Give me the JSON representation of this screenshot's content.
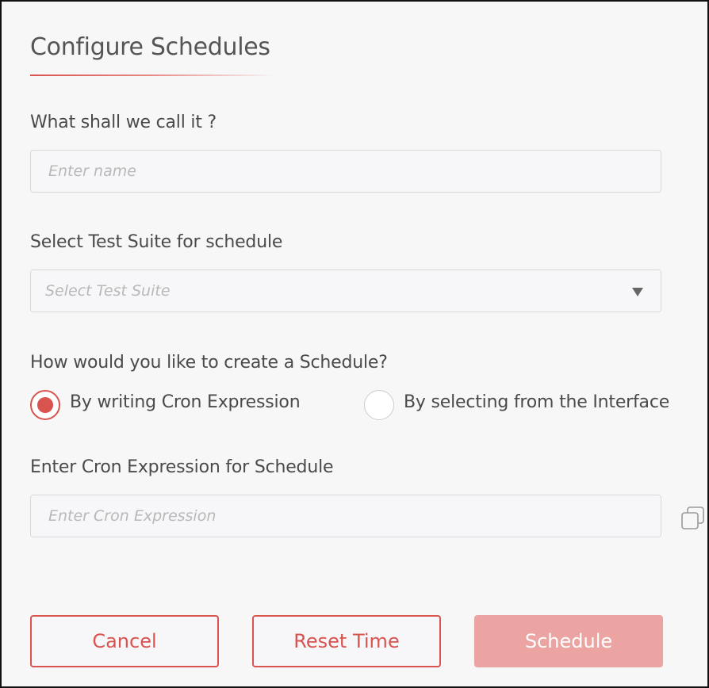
{
  "dialog": {
    "title": "Configure Schedules"
  },
  "name_section": {
    "label": "What shall we call it ?",
    "placeholder": "Enter name",
    "value": ""
  },
  "suite_section": {
    "label": "Select Test Suite for schedule",
    "placeholder": "Select Test Suite",
    "selected": ""
  },
  "mode_section": {
    "label": "How would you like to create a Schedule?",
    "options": [
      {
        "label": "By writing Cron Expression",
        "checked": true
      },
      {
        "label": "By selecting from the Interface",
        "checked": false
      }
    ]
  },
  "cron_section": {
    "label": "Enter Cron Expression for Schedule",
    "placeholder": "Enter Cron Expression",
    "value": "",
    "copy_icon": "copy-icon"
  },
  "actions": {
    "cancel_label": "Cancel",
    "reset_label": "Reset Time",
    "schedule_label": "Schedule"
  },
  "colors": {
    "accent": "#d9534f",
    "primary_disabled": "#eba4a2",
    "text": "#4a4a4a",
    "placeholder": "#b8b8b8"
  }
}
